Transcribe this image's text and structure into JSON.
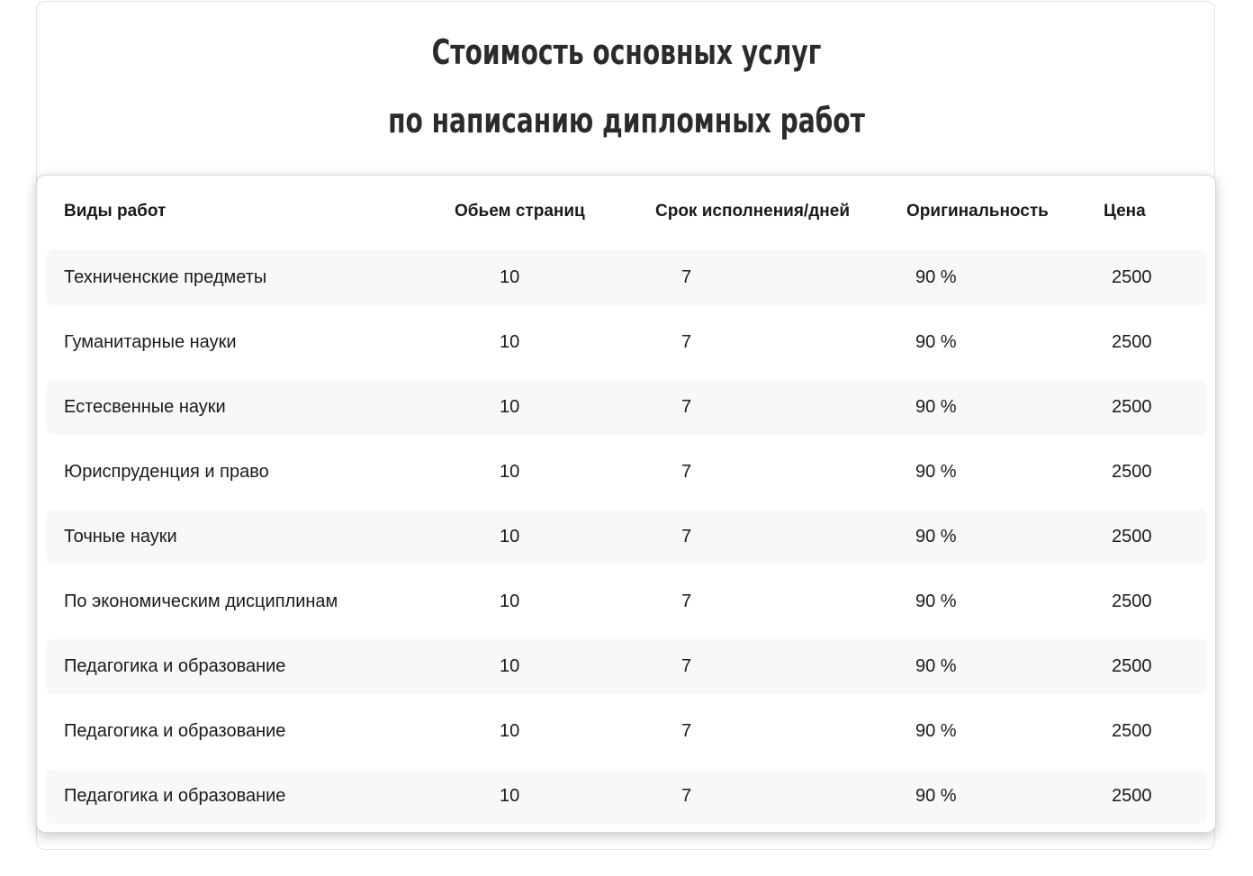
{
  "title": {
    "line1": "Стоимость основных услуг",
    "line2": "по написанию дипломных работ"
  },
  "table": {
    "headers": {
      "type": "Виды работ",
      "pages": "Обьем страниц",
      "days": "Срок исполнения/дней",
      "originality": "Оригинальность",
      "price": "Цена"
    },
    "rows": [
      {
        "type": "Техниченские предметы",
        "pages": "10",
        "days": "7",
        "originality": "90 %",
        "price": "2500"
      },
      {
        "type": "Гуманитарные науки",
        "pages": "10",
        "days": "7",
        "originality": "90 %",
        "price": "2500"
      },
      {
        "type": "Естесвенные науки",
        "pages": "10",
        "days": "7",
        "originality": "90 %",
        "price": "2500"
      },
      {
        "type": "Юриспруденция и право",
        "pages": "10",
        "days": "7",
        "originality": "90 %",
        "price": "2500"
      },
      {
        "type": "Точные науки",
        "pages": "10",
        "days": "7",
        "originality": "90 %",
        "price": "2500"
      },
      {
        "type": "По экономическим дисциплинам",
        "pages": "10",
        "days": "7",
        "originality": "90 %",
        "price": "2500"
      },
      {
        "type": "Педагогика и образование",
        "pages": "10",
        "days": "7",
        "originality": "90 %",
        "price": "2500"
      },
      {
        "type": "Педагогика и образование",
        "pages": "10",
        "days": "7",
        "originality": "90 %",
        "price": "2500"
      },
      {
        "type": "Педагогика и образование",
        "pages": "10",
        "days": "7",
        "originality": "90 %",
        "price": "2500"
      }
    ]
  },
  "colors": {
    "row_shade": "#f8f8f8",
    "text": "#1a1a1a",
    "title": "#2b2b2b"
  }
}
